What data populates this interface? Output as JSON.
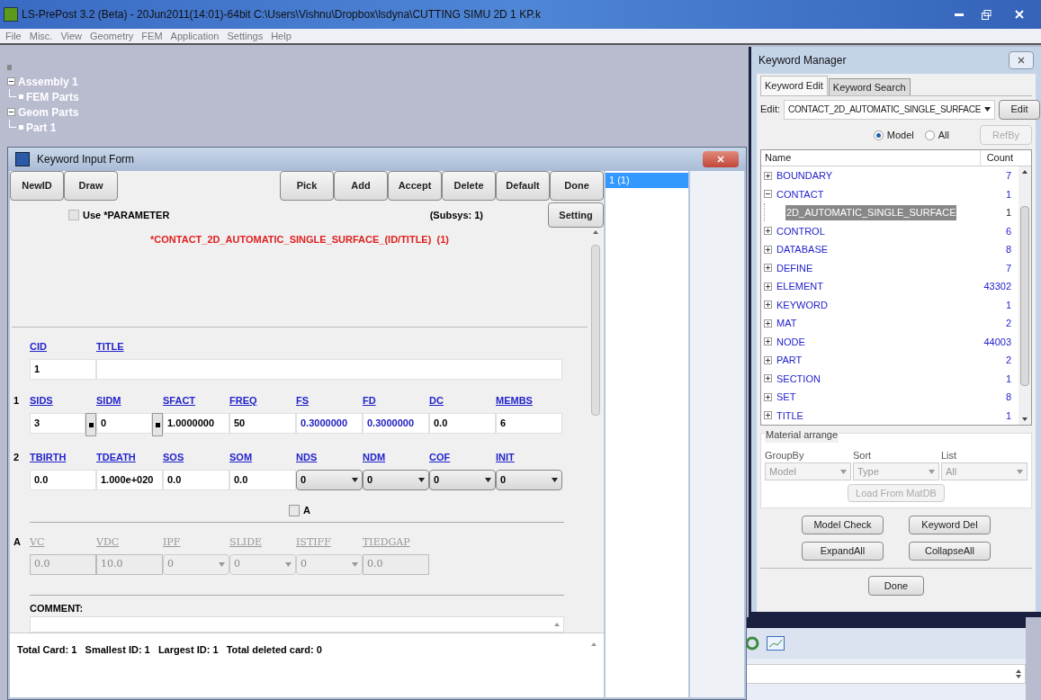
{
  "window": {
    "title": "LS-PrePost 3.2 (Beta) - 20Jun2011(14:01)-64bit C:\\Users\\Vishnu\\Dropbox\\lsdyna\\CUTTING SIMU 2D 1 KP.k"
  },
  "menu": [
    "File",
    "Misc.",
    "View",
    "Geometry",
    "FEM",
    "Application",
    "Settings",
    "Help"
  ],
  "model_tree": [
    {
      "label": "Assembly 1",
      "expanded": true,
      "children": [
        {
          "label": "FEM Parts"
        }
      ]
    },
    {
      "label": "Geom Parts",
      "expanded": true,
      "children": [
        {
          "label": "Part 1"
        }
      ]
    }
  ],
  "keyword_form": {
    "title": "Keyword Input Form",
    "toolbar_left": [
      "NewID",
      "Draw"
    ],
    "toolbar_right": [
      "Pick",
      "Add",
      "Accept",
      "Delete",
      "Default",
      "Done"
    ],
    "use_parameter": {
      "label": "Use *PARAMETER",
      "checked": false
    },
    "subsys": "(Subsys: 1)",
    "setting": "Setting",
    "heading": "*CONTACT_2D_AUTOMATIC_SINGLE_SURFACE_(ID/TITLE)  (1)",
    "cards": [
      {
        "disabled": false,
        "fields": [
          {
            "label": "CID",
            "kind": "text",
            "value": "1"
          },
          {
            "label": "TITLE",
            "kind": "text",
            "wide": true
          }
        ]
      },
      {
        "number": "1",
        "disabled": false,
        "fields": [
          {
            "label": "SIDS",
            "kind": "text",
            "value": "3",
            "pick": true
          },
          {
            "label": "SIDM",
            "kind": "text",
            "value": "0",
            "pick": true
          },
          {
            "label": "SFACT",
            "kind": "text",
            "value": "1.0000000"
          },
          {
            "label": "FREQ",
            "kind": "text",
            "value": "50"
          },
          {
            "label": "FS",
            "kind": "text",
            "value": "0.3000000",
            "modified": true
          },
          {
            "label": "FD",
            "kind": "text",
            "value": "0.3000000",
            "modified": true
          },
          {
            "label": "DC",
            "kind": "text",
            "value": "0.0"
          },
          {
            "label": "MEMBS",
            "kind": "text",
            "value": "6"
          }
        ]
      },
      {
        "number": "2",
        "disabled": false,
        "fields": [
          {
            "label": "TBIRTH",
            "kind": "text",
            "value": "0.0"
          },
          {
            "label": "TDEATH",
            "kind": "text",
            "value": "1.000e+020"
          },
          {
            "label": "SOS",
            "kind": "text",
            "value": "0.0"
          },
          {
            "label": "SOM",
            "kind": "text",
            "value": "0.0"
          },
          {
            "label": "NDS",
            "kind": "select",
            "value": "0"
          },
          {
            "label": "NDM",
            "kind": "select",
            "value": "0"
          },
          {
            "label": "COF",
            "kind": "select",
            "value": "0"
          },
          {
            "label": "INIT",
            "kind": "select",
            "value": "0"
          }
        ]
      }
    ],
    "option": {
      "label": "A",
      "checked": false
    },
    "option_card": {
      "number": "A",
      "disabled": true,
      "fields": [
        {
          "label": "VC",
          "kind": "text",
          "value": "0.0"
        },
        {
          "label": "VDC",
          "kind": "text",
          "value": "10.0"
        },
        {
          "label": "IPF",
          "kind": "select",
          "value": "0"
        },
        {
          "label": "SLIDE",
          "kind": "select",
          "value": "0"
        },
        {
          "label": "ISTIFF",
          "kind": "select",
          "value": "0"
        },
        {
          "label": "TIEDGAP",
          "kind": "text",
          "value": "0.0"
        }
      ]
    },
    "comment_label": "COMMENT:",
    "status": "Total Card: 1   Smallest ID: 1   Largest ID: 1   Total deleted card: 0",
    "id_list": [
      {
        "label": "1 (1)",
        "selected": true
      }
    ]
  },
  "keyword_manager": {
    "title": "Keyword Manager",
    "tabs": [
      {
        "label": "Keyword Edit",
        "selected": true
      },
      {
        "label": "Keyword Search",
        "selected": false
      }
    ],
    "edit_label": "Edit:",
    "edit_value": "CONTACT_2D_AUTOMATIC_SINGLE_SURFACE",
    "edit_button": "Edit",
    "radios": [
      {
        "label": "Model",
        "selected": true
      },
      {
        "label": "All",
        "selected": false
      }
    ],
    "refby": {
      "label": "RefBy",
      "disabled": true
    },
    "columns": [
      "Name",
      "Count"
    ],
    "rows": [
      {
        "name": "BOUNDARY",
        "count": "7",
        "expanded": false,
        "selected": false
      },
      {
        "name": "CONTACT",
        "count": "1",
        "expanded": true,
        "selected": false,
        "children": [
          {
            "name": "2D_AUTOMATIC_SINGLE_SURFACE",
            "count": "1",
            "selected": true
          }
        ]
      },
      {
        "name": "CONTROL",
        "count": "6",
        "expanded": false,
        "selected": false
      },
      {
        "name": "DATABASE",
        "count": "8",
        "expanded": false,
        "selected": false
      },
      {
        "name": "DEFINE",
        "count": "7",
        "expanded": false,
        "selected": false
      },
      {
        "name": "ELEMENT",
        "count": "43302",
        "expanded": false,
        "selected": false
      },
      {
        "name": "KEYWORD",
        "count": "1",
        "expanded": false,
        "selected": false
      },
      {
        "name": "MAT",
        "count": "2",
        "expanded": false,
        "selected": false
      },
      {
        "name": "NODE",
        "count": "44003",
        "expanded": false,
        "selected": false
      },
      {
        "name": "PART",
        "count": "2",
        "expanded": false,
        "selected": false
      },
      {
        "name": "SECTION",
        "count": "1",
        "expanded": false,
        "selected": false
      },
      {
        "name": "SET",
        "count": "8",
        "expanded": false,
        "selected": false
      },
      {
        "name": "TITLE",
        "count": "1",
        "expanded": false,
        "selected": false
      }
    ],
    "material": {
      "title": "Material arrange",
      "selects": [
        {
          "label": "GroupBy",
          "value": "Model"
        },
        {
          "label": "Sort",
          "value": "Type"
        },
        {
          "label": "List",
          "value": "All"
        }
      ],
      "load_button": {
        "label": "Load From MatDB",
        "disabled": true
      }
    },
    "buttons": [
      "Model Check",
      "Keyword Del",
      "ExpandAll",
      "CollapseAll"
    ],
    "done": "Done"
  }
}
